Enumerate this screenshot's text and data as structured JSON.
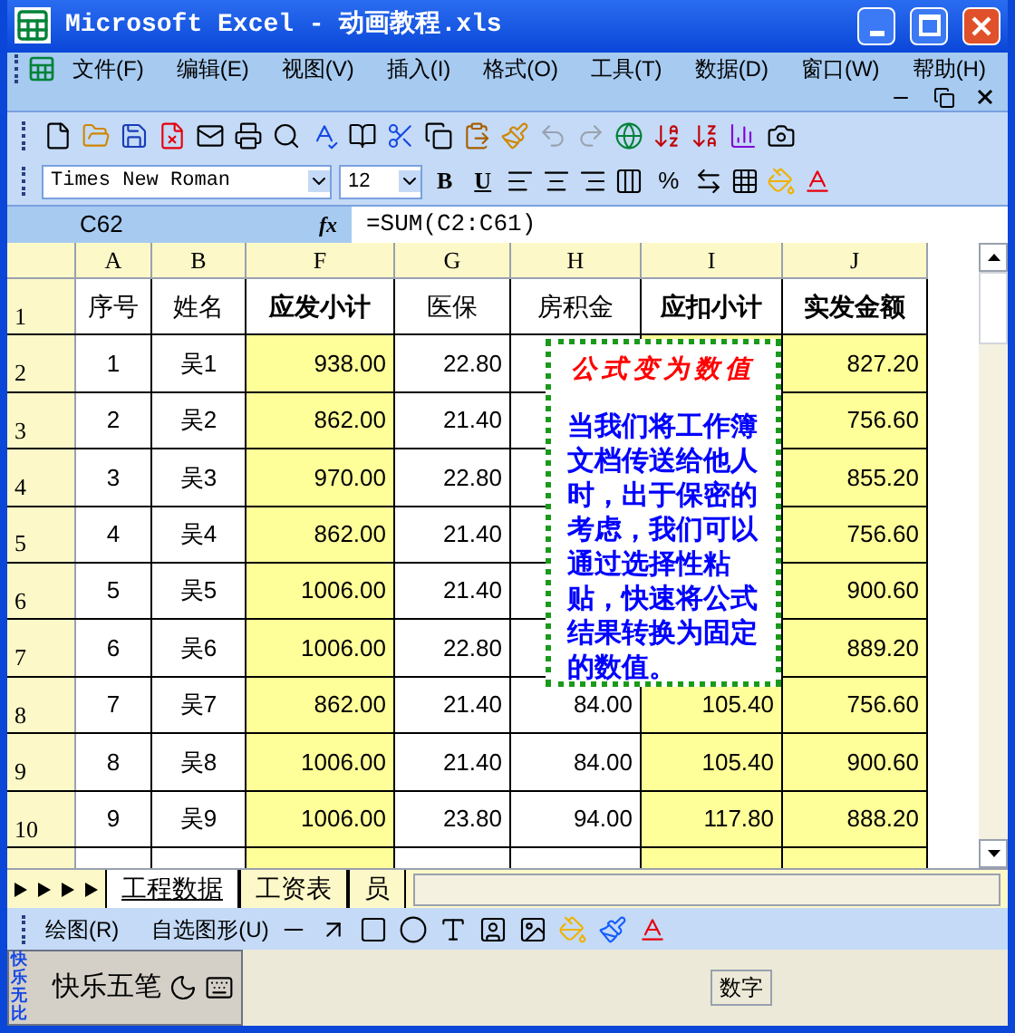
{
  "window": {
    "title": "Microsoft Excel - 动画教程.xls"
  },
  "menu": [
    "文件(F)",
    "编辑(E)",
    "视图(V)",
    "插入(I)",
    "格式(O)",
    "工具(T)",
    "数据(D)",
    "窗口(W)",
    "帮助(H)"
  ],
  "format_bar": {
    "font": "Times New Roman",
    "size": "12",
    "bold": "B",
    "underline": "U",
    "percent": "%"
  },
  "formula_bar": {
    "name_box": "C62",
    "fx": "fx",
    "formula": "=SUM(C2:C61)"
  },
  "columns": [
    {
      "letter": "A",
      "highlighted": false
    },
    {
      "letter": "B",
      "highlighted": false
    },
    {
      "letter": "F",
      "highlighted": true
    },
    {
      "letter": "G",
      "highlighted": false
    },
    {
      "letter": "H",
      "highlighted": false
    },
    {
      "letter": "I",
      "highlighted": true
    },
    {
      "letter": "J",
      "highlighted": true
    }
  ],
  "header_row": {
    "number": "1",
    "cells": [
      {
        "text": "序号",
        "bold": false
      },
      {
        "text": "姓名",
        "bold": false
      },
      {
        "text": "应发小计",
        "bold": true
      },
      {
        "text": "医保",
        "bold": false
      },
      {
        "text": "房积金",
        "bold": false
      },
      {
        "text": "应扣小计",
        "bold": true
      },
      {
        "text": "实发金额",
        "bold": true
      }
    ]
  },
  "rows": [
    {
      "number": "2",
      "cells": [
        "1",
        "吴1",
        "938.00",
        "22.80",
        null,
        null,
        "827.20"
      ]
    },
    {
      "number": "3",
      "cells": [
        "2",
        "吴2",
        "862.00",
        "21.40",
        null,
        null,
        "756.60"
      ]
    },
    {
      "number": "4",
      "cells": [
        "3",
        "吴3",
        "970.00",
        "22.80",
        null,
        null,
        "855.20"
      ]
    },
    {
      "number": "5",
      "cells": [
        "4",
        "吴4",
        "862.00",
        "21.40",
        null,
        null,
        "756.60"
      ]
    },
    {
      "number": "6",
      "cells": [
        "5",
        "吴5",
        "1006.00",
        "21.40",
        null,
        null,
        "900.60"
      ]
    },
    {
      "number": "7",
      "cells": [
        "6",
        "吴6",
        "1006.00",
        "22.80",
        null,
        null,
        "889.20"
      ]
    },
    {
      "number": "8",
      "cells": [
        "7",
        "吴7",
        "862.00",
        "21.40",
        "84.00",
        "105.40",
        "756.60"
      ]
    },
    {
      "number": "9",
      "cells": [
        "8",
        "吴8",
        "1006.00",
        "21.40",
        "84.00",
        "105.40",
        "900.60"
      ]
    },
    {
      "number": "10",
      "cells": [
        "9",
        "吴9",
        "1006.00",
        "23.80",
        "94.00",
        "117.80",
        "888.20"
      ]
    }
  ],
  "note": {
    "title": "公式变为数值",
    "body": "当我们将工作簿文档传送给他人时，出于保密的考虑，我们可以通过选择性粘贴，快速将公式结果转换为固定的数值。"
  },
  "sheet_tabs": [
    {
      "label": "工程数据",
      "selected": true
    },
    {
      "label": "工资表",
      "selected": false
    },
    {
      "label": "员",
      "selected": false
    }
  ],
  "drawing_bar": {
    "draw": "绘图(R)",
    "autoshapes": "自选图形(U)"
  },
  "status_bar": {
    "mode": "数字"
  },
  "ime_bar": {
    "logo": "快乐无比",
    "name": "快乐五笔"
  }
}
